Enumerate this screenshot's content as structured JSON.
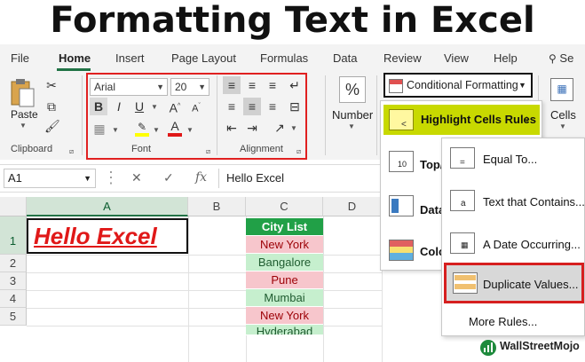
{
  "title": "Formatting Text in Excel",
  "tabs": [
    "File",
    "Home",
    "Insert",
    "Page Layout",
    "Formulas",
    "Data",
    "Review",
    "View",
    "Help",
    "Se"
  ],
  "active_tab": "Home",
  "clipboard": {
    "paste_label": "Paste",
    "group_label": "Clipboard"
  },
  "font": {
    "name": "Arial",
    "size": "20",
    "group_label": "Font",
    "bold": "B",
    "italic": "I",
    "underline": "U",
    "font_color": "A"
  },
  "alignment": {
    "group_label": "Alignment"
  },
  "number": {
    "label": "Number",
    "symbol": "%"
  },
  "cells": {
    "label": "Cells"
  },
  "conditional_formatting": {
    "button_label": "Conditional Formatting",
    "menu": [
      "Highlight Cells Rules",
      "Top/B",
      "Data",
      "Color"
    ],
    "submenu": [
      "Equal To...",
      "Text that Contains...",
      "A Date Occurring...",
      "Duplicate Values...",
      "More Rules..."
    ]
  },
  "formula_bar": {
    "name_box": "A1",
    "cancel": "✕",
    "enter": "✓",
    "fx": "fx",
    "value": "Hello Excel"
  },
  "columns": [
    "A",
    "B",
    "C",
    "D"
  ],
  "rows": [
    "1",
    "2",
    "3",
    "4",
    "5"
  ],
  "cell_a1": "Hello Excel",
  "city_list": {
    "header": "City List",
    "items": [
      "New York",
      "Bangalore",
      "Pune",
      "Mumbai",
      "New York",
      "Hyderabad"
    ]
  },
  "logo": "WallStreetMojo",
  "colors": {
    "excel_green": "#217346",
    "duplicate_fill": "#f7c6cc",
    "unique_fill": "#c6efce",
    "highlight_yellow": "#c8d900",
    "annotation_red": "#e02020"
  }
}
